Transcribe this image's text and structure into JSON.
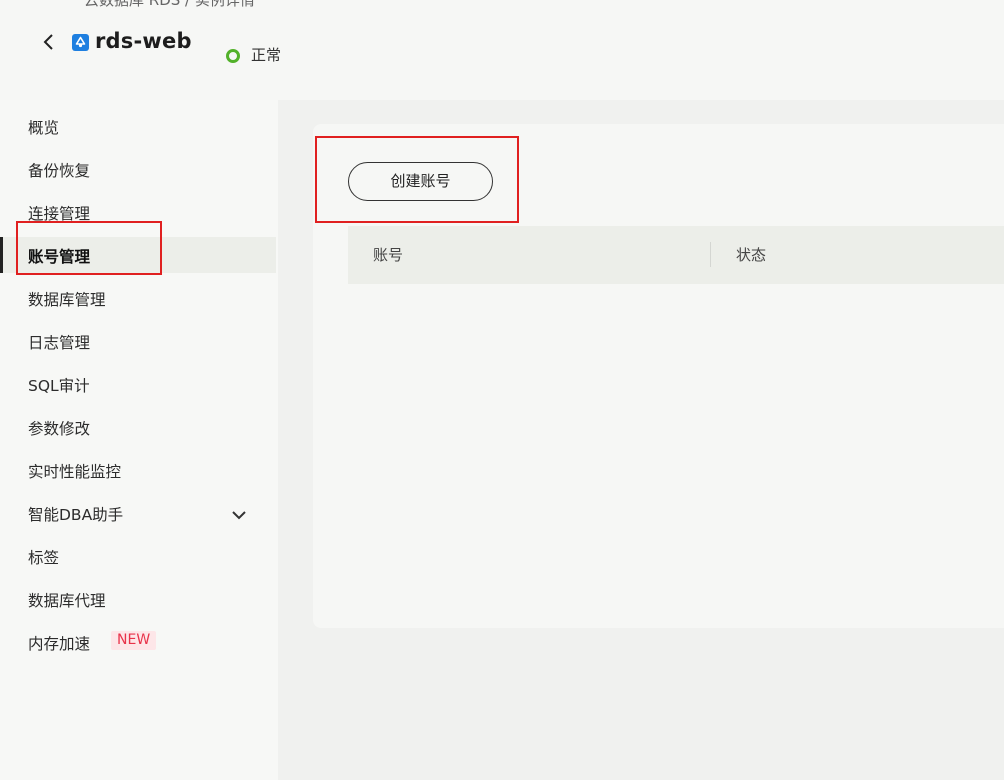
{
  "header": {
    "breadcrumb": "云数据库 RDS / 实例详情",
    "instance_name": "rds-web",
    "status": "正常",
    "status_color": "#52b12a"
  },
  "sidebar": {
    "items": [
      {
        "label": "概览"
      },
      {
        "label": "备份恢复"
      },
      {
        "label": "连接管理"
      },
      {
        "label": "账号管理"
      },
      {
        "label": "数据库管理"
      },
      {
        "label": "日志管理"
      },
      {
        "label": "SQL审计"
      },
      {
        "label": "参数修改"
      },
      {
        "label": "实时性能监控"
      },
      {
        "label": "智能DBA助手"
      },
      {
        "label": "标签"
      },
      {
        "label": "数据库代理"
      },
      {
        "label": "内存加速"
      }
    ],
    "active_item": "账号管理",
    "new_badge": "NEW"
  },
  "main": {
    "create_button_label": "创建账号",
    "table": {
      "columns": [
        "账号",
        "状态"
      ],
      "rows": []
    }
  },
  "colors": {
    "highlight_border": "#e02020",
    "brand_blue": "#1e7fe0",
    "badge_text": "#e8334a"
  }
}
